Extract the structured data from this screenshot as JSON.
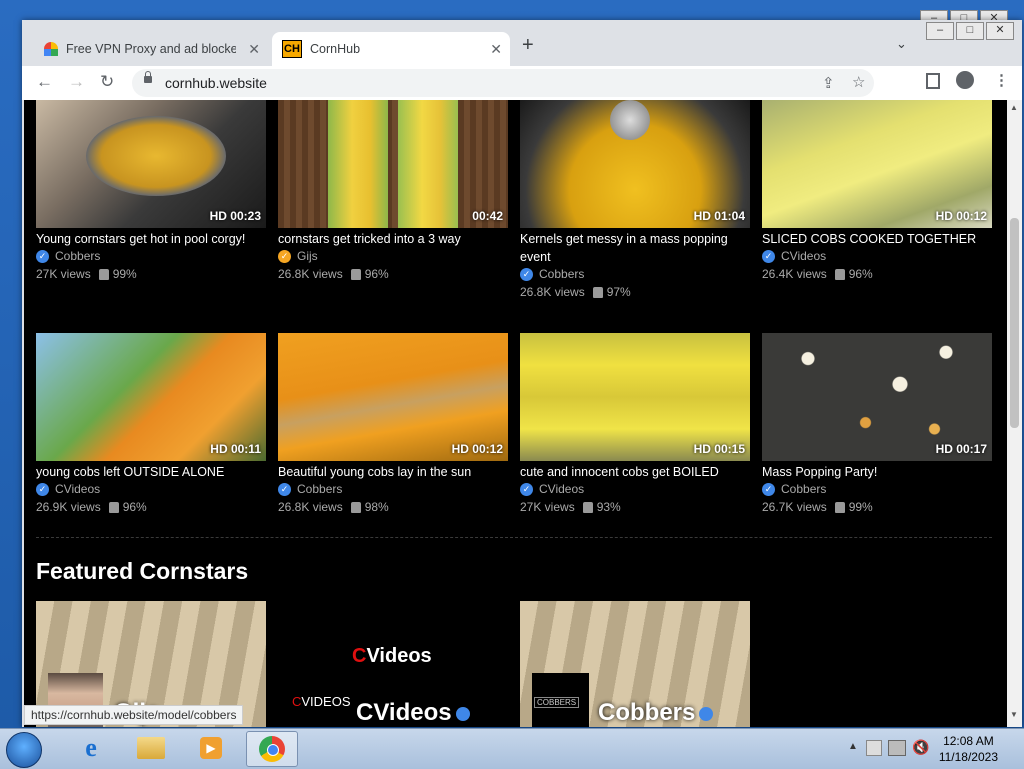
{
  "browser": {
    "tabs": [
      {
        "title": "Free VPN Proxy and ad blocker -",
        "favicon": "rainbow-icon",
        "active": false
      },
      {
        "title": "CornHub",
        "favicon": "CH",
        "active": true
      }
    ],
    "url": "cornhub.website",
    "status_url": "https://cornhub.website/model/cobbers"
  },
  "videos": [
    {
      "title": "Young cornstars get hot in pool corgy!",
      "channel": "Cobbers",
      "channel_badge": "blue",
      "views": "27K views",
      "rating": "99%",
      "duration": "HD 00:23"
    },
    {
      "title": "cornstars get tricked into a 3 way",
      "channel": "Gijs",
      "channel_badge": "gold",
      "views": "26.8K views",
      "rating": "96%",
      "duration": "00:42"
    },
    {
      "title": "Kernels get messy in a mass popping event",
      "channel": "Cobbers",
      "channel_badge": "blue",
      "views": "26.8K views",
      "rating": "97%",
      "duration": "HD 01:04"
    },
    {
      "title": "SLICED COBS COOKED TOGETHER",
      "channel": "CVideos",
      "channel_badge": "blue",
      "views": "26.4K views",
      "rating": "96%",
      "duration": "HD 00:12"
    },
    {
      "title": "young cobs left OUTSIDE ALONE",
      "channel": "CVideos",
      "channel_badge": "blue",
      "views": "26.9K views",
      "rating": "96%",
      "duration": "HD 00:11"
    },
    {
      "title": "Beautiful young cobs lay in the sun",
      "channel": "Cobbers",
      "channel_badge": "blue",
      "views": "26.8K views",
      "rating": "98%",
      "duration": "HD 00:12"
    },
    {
      "title": "cute and innocent cobs get BOILED",
      "channel": "CVideos",
      "channel_badge": "blue",
      "views": "27K views",
      "rating": "93%",
      "duration": "HD 00:15"
    },
    {
      "title": "Mass Popping Party!",
      "channel": "Cobbers",
      "channel_badge": "blue",
      "views": "26.7K views",
      "rating": "99%",
      "duration": "HD 00:17"
    }
  ],
  "featured": {
    "title": "Featured Cornstars",
    "stars": [
      {
        "name": "Gijs",
        "badge": "gold"
      },
      {
        "name": "CVideos",
        "badge": "blue",
        "logo_text": "VIDEOS",
        "logo_initial": "C"
      },
      {
        "name": "Cobbers",
        "badge": "blue",
        "logo_text": "COBBERS"
      }
    ]
  },
  "taskbar": {
    "time": "12:08 AM",
    "date": "11/18/2023"
  }
}
